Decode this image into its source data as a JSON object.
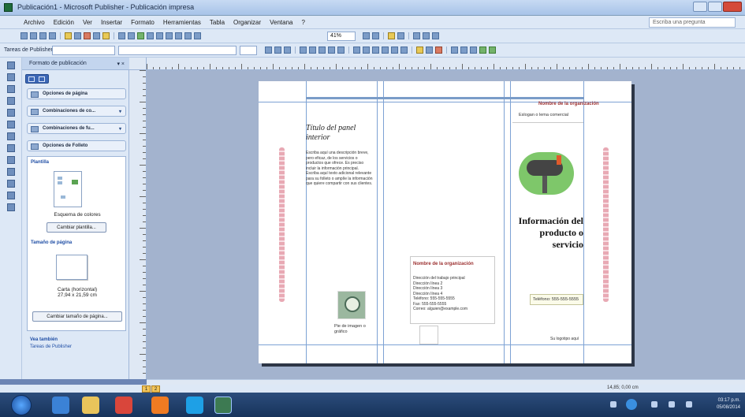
{
  "window": {
    "title": "Publicación1 - Microsoft Publisher - Publicación impresa"
  },
  "menu": {
    "items": [
      "Archivo",
      "Edición",
      "Ver",
      "Insertar",
      "Formato",
      "Herramientas",
      "Tabla",
      "Organizar",
      "Ventana",
      "?"
    ],
    "help_placeholder": "Escriba una pregunta"
  },
  "toolbar": {
    "zoom": "41%",
    "style_box": "Tareas de Publisher"
  },
  "taskpane": {
    "header": "Formato de publicación",
    "sections": [
      "Opciones de página",
      "Combinaciones de co...",
      "Combinaciones de fu...",
      "Opciones de Folleto"
    ],
    "plantilla_label": "Plantilla",
    "color_scheme": "Esquema de colores",
    "change_template_btn": "Cambiar plantilla...",
    "page_size_label": "Tamaño de página",
    "page_size_text": "Carta (horizontal)\n27,94 x 21,59 cm",
    "change_page_size_btn": "Cambiar tamaño de página...",
    "bottom_links": [
      "Vea también",
      "Tareas de Publisher"
    ]
  },
  "document": {
    "inner_title": "Título del panel interior",
    "inner_body": "Escriba aquí una descripción breve, pero eficaz, de los servicios o productos que ofrece. Es preciso incluir la información principal.\nEscriba aquí texto adicional relevante para su folleto o amplíe la información que quiere compartir con sus clientes.",
    "caption": "Pie de imagen o gráfico",
    "back_org": "Nombre de la organización",
    "back_address": "Dirección del trabajo principal\nDirección línea 2\nDirección línea 3\nDirección línea 4\nTeléfono: 555-555-5555\nFax: 555-555-5555\nCorreo: alguien@example.com",
    "front_org": "Nombre de la organización",
    "front_tagline": "Eslogan o lema comercial",
    "front_title": "Información del producto o servicio",
    "front_phone": "Teléfono: 555-555-5555",
    "front_bottom": "Su logotipo aquí"
  },
  "statusbar": {
    "pages": [
      "1",
      "2"
    ],
    "position": "14,85; 0,00 cm"
  },
  "clock": {
    "time": "03:17 p.m.",
    "date": "05/08/2014"
  }
}
